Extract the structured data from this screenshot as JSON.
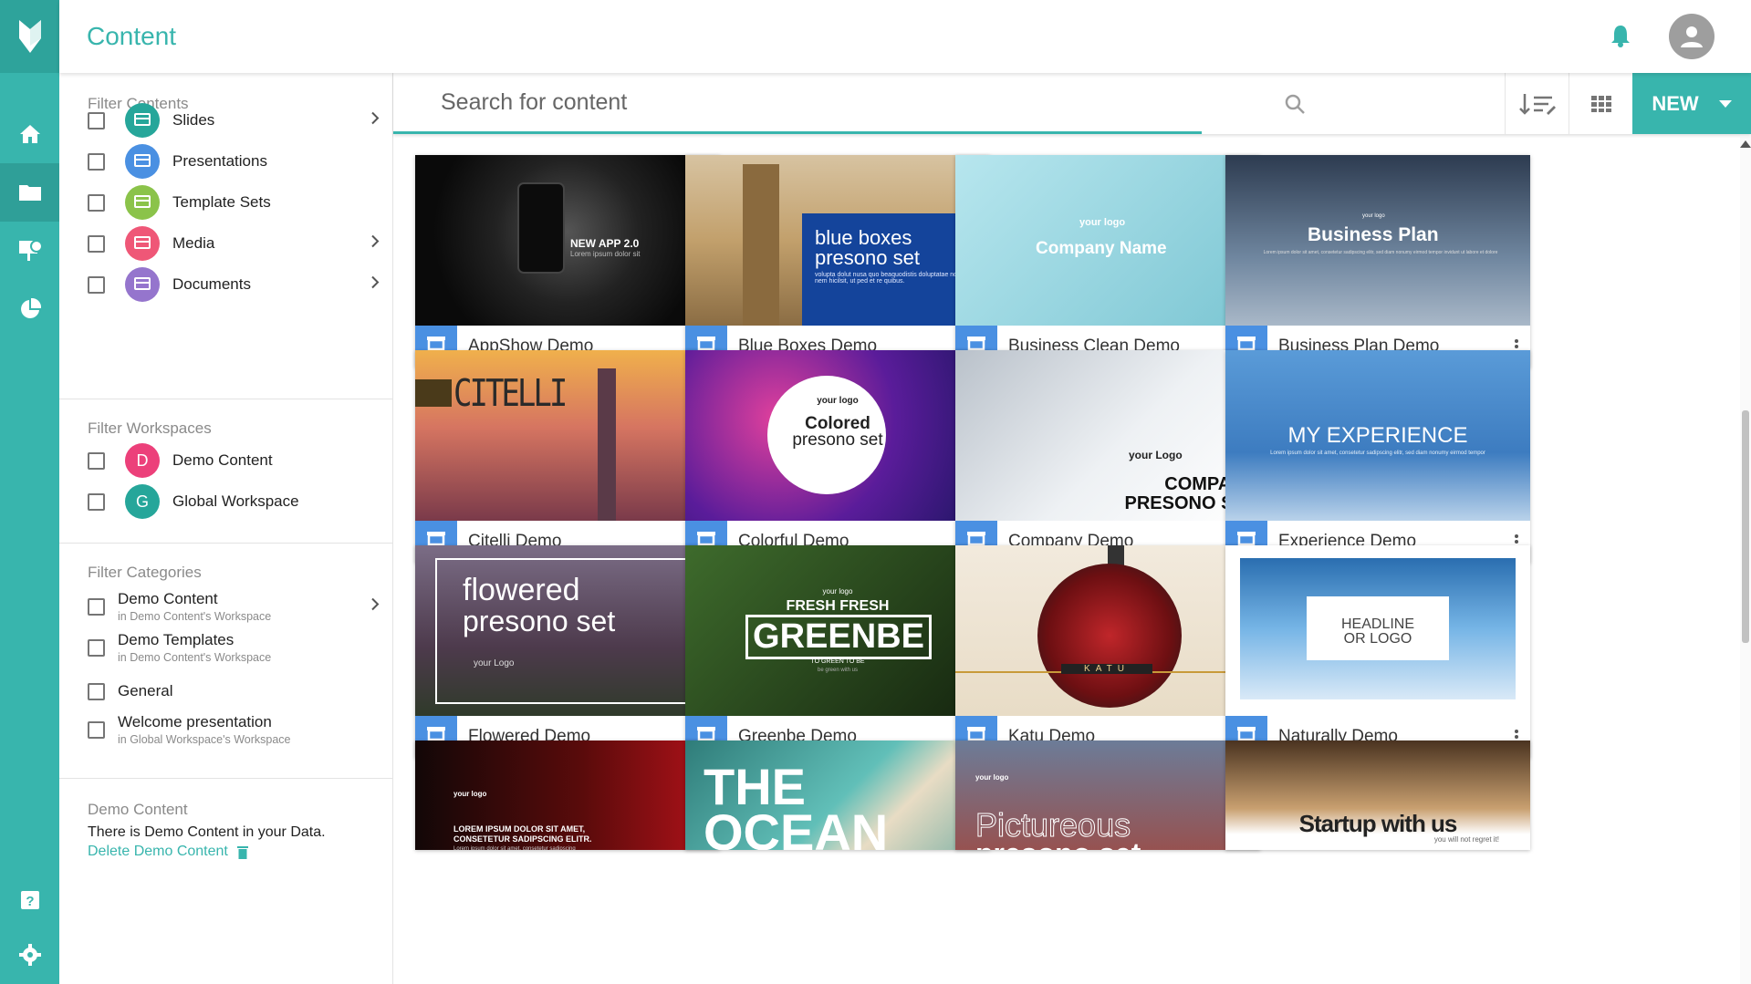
{
  "app": {
    "title": "Content",
    "accent": "#38b5ad",
    "accent_dark": "#2ea39b"
  },
  "rail": {
    "items": [
      "home-icon",
      "folder-icon",
      "presentation-icon",
      "chart-icon"
    ],
    "bottom": [
      "help-icon",
      "settings-icon"
    ]
  },
  "search": {
    "placeholder": "Search for content"
  },
  "toolbar": {
    "new_label": "NEW"
  },
  "filters": {
    "contents": {
      "title": "Filter Contents",
      "items": [
        {
          "label": "Slides",
          "color": "#26a69a",
          "icon": "slides-icon",
          "chevron": true
        },
        {
          "label": "Presentations",
          "color": "#4a90e2",
          "icon": "presentation-icon",
          "chevron": false
        },
        {
          "label": "Template Sets",
          "color": "#8bc34a",
          "icon": "template-icon",
          "chevron": false
        },
        {
          "label": "Media",
          "color": "#ef5777",
          "icon": "media-icon",
          "chevron": true
        },
        {
          "label": "Documents",
          "color": "#9575cd",
          "icon": "document-icon",
          "chevron": true
        }
      ]
    },
    "workspaces": {
      "title": "Filter Workspaces",
      "items": [
        {
          "label": "Demo Content",
          "letter": "D",
          "color": "#ec407a"
        },
        {
          "label": "Global Workspace",
          "letter": "G",
          "color": "#26a69a"
        }
      ]
    },
    "categories": {
      "title": "Filter Categories",
      "items": [
        {
          "label": "Demo Content",
          "sub": "in Demo Content's Workspace",
          "chevron": true
        },
        {
          "label": "Demo Templates",
          "sub": "in Demo Content's Workspace",
          "chevron": false
        },
        {
          "label": "General",
          "sub": "",
          "chevron": false
        },
        {
          "label": "Welcome presentation",
          "sub": "in Global Workspace's Workspace",
          "chevron": false
        }
      ]
    },
    "demo": {
      "title": "Demo Content",
      "text": "There is Demo Content in your Data.",
      "link": "Delete Demo Content"
    }
  },
  "cards": [
    {
      "name": "AppShow Demo",
      "t1": "NEW APP 2.0",
      "t2": "Lorem ipsum dolor sit",
      "bg": "#111"
    },
    {
      "name": "Blue Boxes Demo",
      "t1": "blue boxes",
      "t2": "presono set",
      "t3": "volupta dolut nusa quo beaquodistis doluptatae non esse nem hicilsit, ut ped et re quibus.",
      "bg": "#c9a66b"
    },
    {
      "name": "Business Clean Demo",
      "t1": "your logo",
      "t2": "Company Name",
      "bg": "#8fd0dc"
    },
    {
      "name": "Business Plan Demo",
      "t1": "your logo",
      "t2": "Business Plan",
      "t3": "Lorem ipsum dolor sit amet, consetetur sadipscing elitr, sed diam nonumy eirmod tempor invidunt ut labore et dolore",
      "bg": "#5b6c80"
    },
    {
      "name": "Citelli Demo",
      "t1": "CITELLI",
      "bg": "#d98a5a"
    },
    {
      "name": "Colorful Demo",
      "t1": "your logo",
      "t2": "Colored",
      "t3": "presono set",
      "bg": "#2a1a6e"
    },
    {
      "name": "Company Demo",
      "t1": "your Logo",
      "t2": "COMPANY",
      "t3": "PRESONO SET",
      "bg": "#d8dde3"
    },
    {
      "name": "Experience Demo",
      "t1": "MY EXPERIENCE",
      "t2": "Lorem ipsum dolor sit amet, consetetur sadipscing elitr, sed diam nonumy eirmod tempor",
      "bg": "#4a8cc9"
    },
    {
      "name": "Flowered Demo",
      "t1": "flowered",
      "t2": "presono set",
      "t3": "your Logo",
      "bg": "#6a5a6f"
    },
    {
      "name": "Greenbe Demo",
      "t1": "your logo",
      "t2": "FRESH FRESH",
      "t3": "GREENBE",
      "t4": "TO GREEN TO BE",
      "t5": "be green with us",
      "bg": "#1f3a1d"
    },
    {
      "name": "Katu Demo",
      "t1": "KATU",
      "bg": "#efe6d6"
    },
    {
      "name": "Naturally Demo",
      "t1": "HEADLINE",
      "t2": "OR LOGO",
      "bg": "#fff"
    },
    {
      "name": "",
      "t1": "your logo",
      "t2": "LOREM IPSUM DOLOR SIT AMET,",
      "t3": "CONSETETUR SADIPSCING ELITR.",
      "t4": "Lorem ipsum dolor sit amet, consetetur sadipscing",
      "bg": "#3a0a0a"
    },
    {
      "name": "",
      "t1": "THE",
      "t2": "OCEAN",
      "bg": "#3b8f8a"
    },
    {
      "name": "",
      "t1": "your logo",
      "t2": "Pictureous",
      "t3": "presono set",
      "bg": "#5d6b86"
    },
    {
      "name": "",
      "t1": "Startup with us",
      "t2": "you will not regret it!",
      "bg": "#6b4a2a"
    }
  ]
}
